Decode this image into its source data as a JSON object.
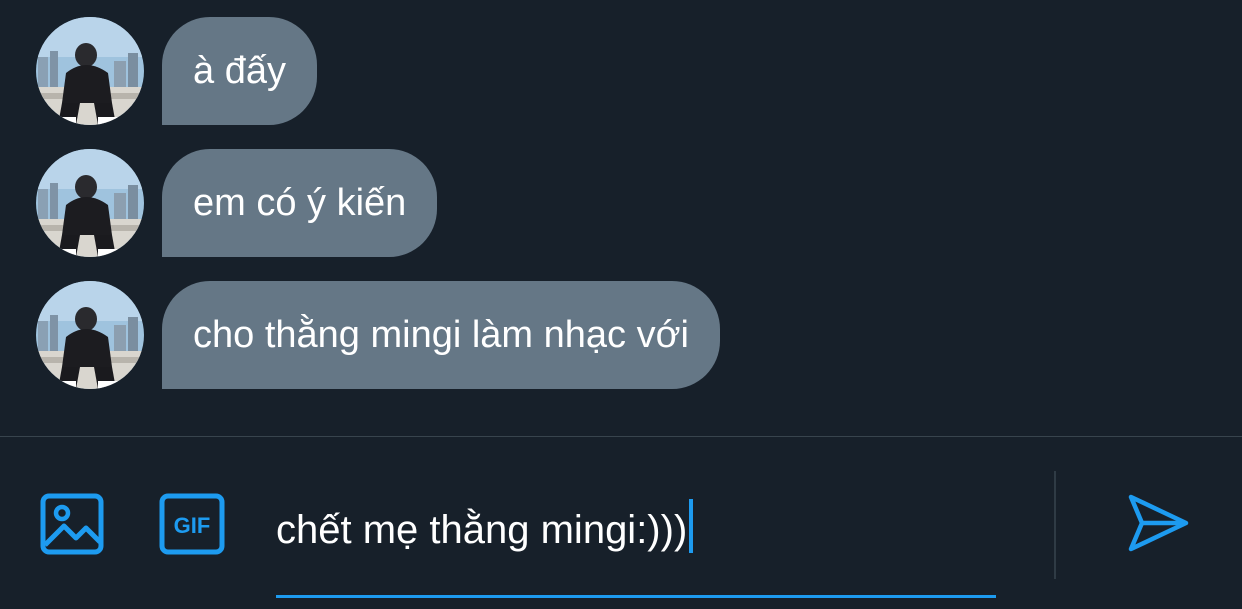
{
  "conversation": {
    "messages": [
      {
        "text": "à đấy",
        "sender": "other"
      },
      {
        "text": "em có ý kiến",
        "sender": "other"
      },
      {
        "text": "cho thằng mingi làm nhạc với",
        "sender": "other"
      }
    ]
  },
  "composer": {
    "input_value": "chết mẹ thằng mingi:)))",
    "media_icon": "image-icon",
    "gif_label": "GIF",
    "send_icon": "send-icon"
  },
  "colors": {
    "background": "#17202a",
    "bubble": "#657786",
    "accent": "#1d9bf0",
    "divider": "#38444d"
  }
}
